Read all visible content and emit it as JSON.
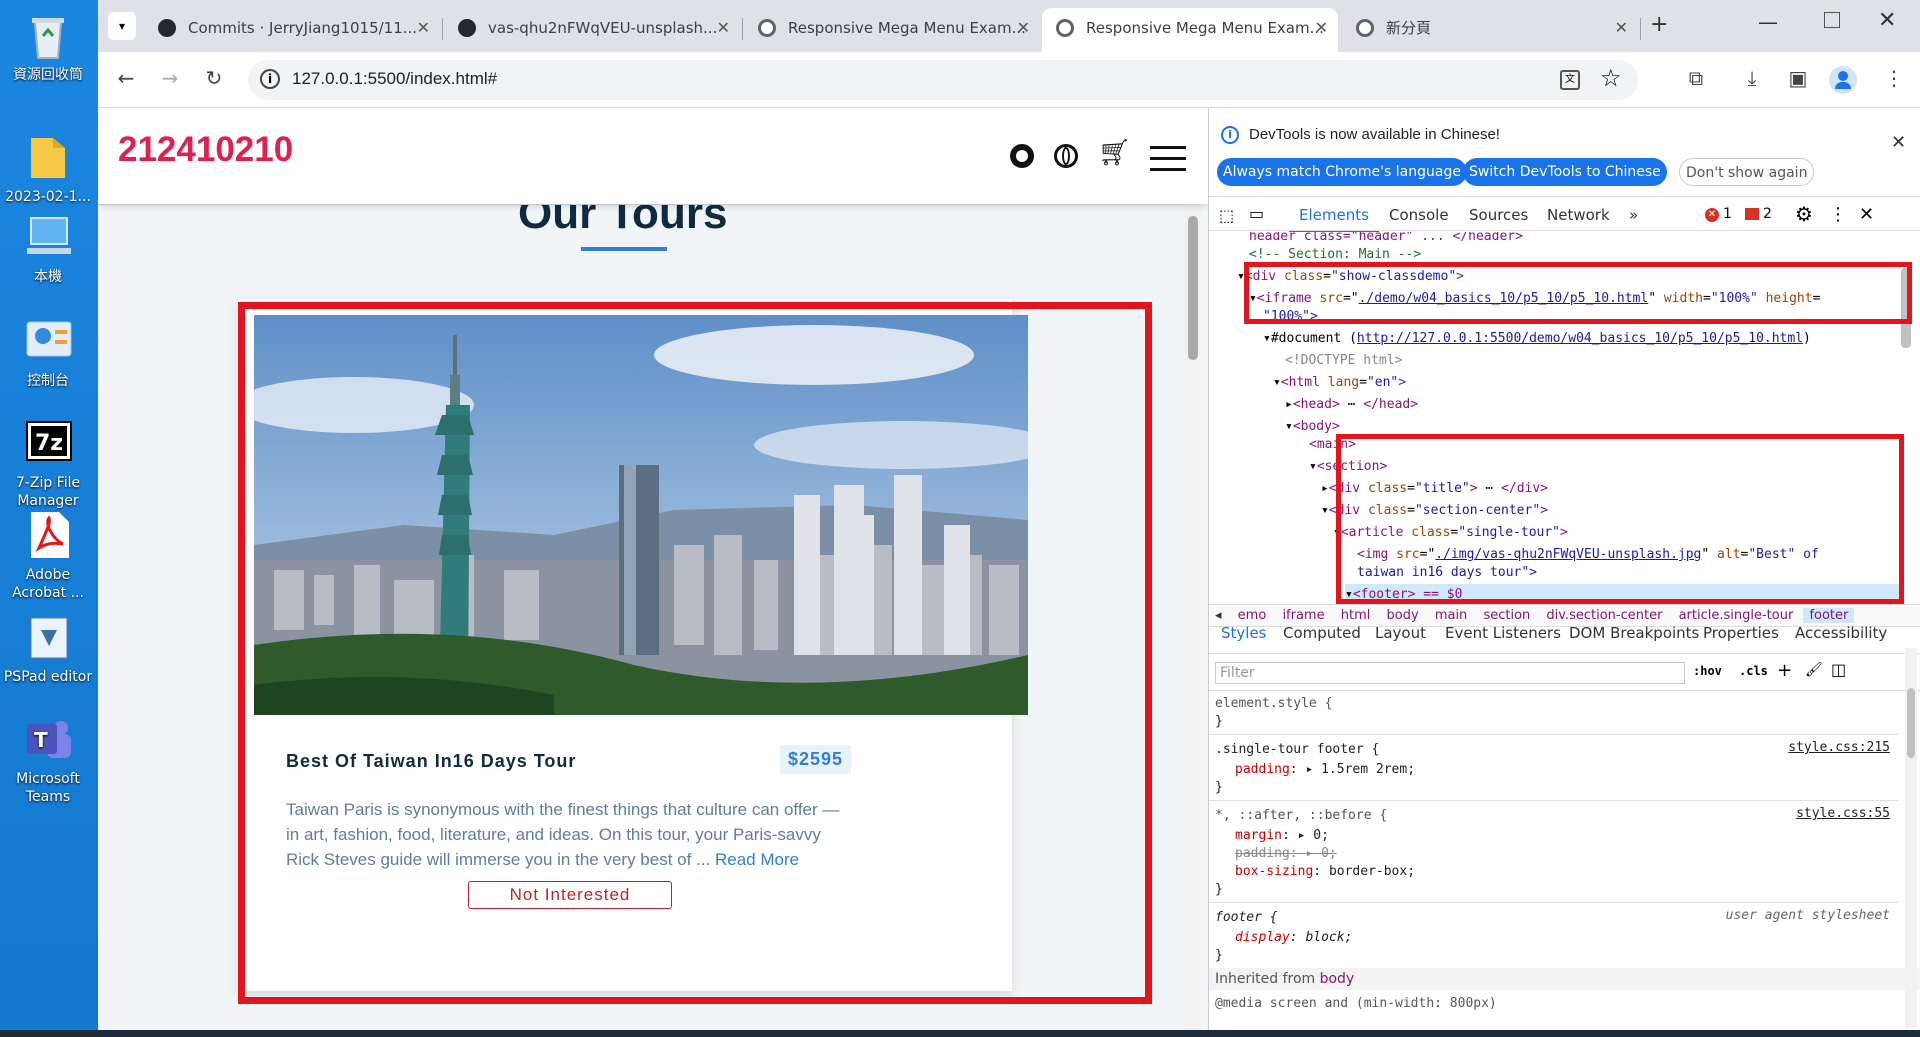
{
  "desktop": {
    "icons": [
      {
        "label": "資源回收筒",
        "icon": "recycle-bin-icon"
      },
      {
        "label": "2023-02-1...",
        "icon": "folder-icon"
      },
      {
        "label": "本機",
        "icon": "computer-icon"
      },
      {
        "label": "控制台",
        "icon": "control-panel-icon"
      },
      {
        "label": "7-Zip File Manager",
        "icon": "7zip-icon"
      },
      {
        "label": "Adobe Acrobat ...",
        "icon": "acrobat-icon"
      },
      {
        "label": "PSPad editor",
        "icon": "pspad-icon"
      },
      {
        "label": "Microsoft Teams",
        "icon": "teams-icon"
      }
    ]
  },
  "browser": {
    "tabs": [
      {
        "title": "Commits · JerryJiang1015/11..."
      },
      {
        "title": "vas-qhu2nFWqVEU-unsplash..."
      },
      {
        "title": "Responsive Mega Menu Exam..."
      },
      {
        "title": "Responsive Mega Menu Exam..."
      },
      {
        "title": "新分頁"
      }
    ],
    "url": "127.0.0.1:5500/index.html#"
  },
  "site": {
    "brand": "212410210",
    "section_title": "Our Tours",
    "tour": {
      "title": "Best Of Taiwan In16 Days Tour",
      "price": "$2595",
      "text": "Taiwan Paris is synonymous with the finest things that culture can offer — in art, fashion, food, literature, and ideas. On this tour, your Paris-savvy Rick Steves guide will immerse you in the very best of ...",
      "read_more": "Read More",
      "button": "Not Interested"
    }
  },
  "devtools": {
    "banner": "DevTools is now available in Chinese!",
    "btn_match": "Always match Chrome's language",
    "btn_switch": "Switch DevTools to Chinese",
    "btn_dont": "Don't show again",
    "tabs": [
      "Elements",
      "Console",
      "Sources",
      "Network"
    ],
    "errors": "1",
    "warnings": "2",
    "dom": {
      "l0": "header class=\"header\" ... </header>",
      "l1": "<!-- Section: Main -->",
      "l2a": "<div ",
      "l2b": "class",
      "l2c": "\"show-classdemo\"",
      "l3a": "<iframe ",
      "l3b": "src",
      "l3c": "./demo/w04_basics_10/p5_10/p5_10.html",
      "l3d": "width",
      "l3e": "\"100%\"",
      "l3f": "height",
      "l4": "\"100%\">",
      "l5a": "#document (",
      "l5b": "http://127.0.0.1:5500/demo/w04_basics_10/p5_10/p5_10.html",
      "l5c": ")",
      "l6": "<!DOCTYPE html>",
      "l7a": "<html ",
      "l7b": "lang",
      "l7c": "\"en\"",
      "l8": "<head>",
      "l8b": "</head>",
      "l9": "<body>",
      "l10": "<main>",
      "l11": "<section>",
      "l12a": "<div ",
      "l12b": "class",
      "l12c": "\"title\"",
      "l12d": "</div>",
      "l13a": "<div ",
      "l13b": "class",
      "l13c": "\"section-center\"",
      "l14a": "<article ",
      "l14b": "class",
      "l14c": "\"single-tour\"",
      "l15a": "<img ",
      "l15b": "src",
      "l15c": "./img/vas-qhu2nFWqVEU-unsplash.jpg",
      "l15d": "alt",
      "l15e": "\"Best\" of",
      "l16": "taiwan in16 days tour\">",
      "l17": "<footer> == $0"
    },
    "breadcrumb": [
      "emo",
      "iframe",
      "html",
      "body",
      "main",
      "section",
      "div.section-center",
      "article.single-tour",
      "footer"
    ],
    "style_tabs": [
      "Styles",
      "Computed",
      "Layout",
      "Event Listeners",
      "DOM Breakpoints",
      "Properties",
      "Accessibility"
    ],
    "filter_placeholder": "Filter",
    "hov": ":hov",
    "cls": ".cls",
    "rules": {
      "r1": "element.style {",
      "close": "}",
      "r2": ".single-tour footer {",
      "r2src": "style.css:215",
      "r2p": "padding",
      "r2v": "1.5rem 2rem;",
      "r3": "*, ::after, ::before {",
      "r3src": "style.css:55",
      "r3p1": "margin",
      "r3v1": "0;",
      "r3p2": "padding",
      "r3v2": "0;",
      "r3p3": "box-sizing",
      "r3v3": "border-box;",
      "r4": "footer {",
      "r4src": "user agent stylesheet",
      "r4p": "display",
      "r4v": "block;",
      "inherited": "Inherited from ",
      "inherited_el": "body",
      "media": "@media screen and (min-width: 800px)"
    }
  }
}
